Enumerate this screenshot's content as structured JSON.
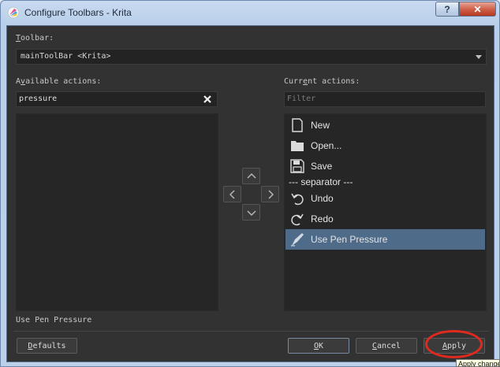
{
  "window": {
    "title": "Configure Toolbars - Krita",
    "help_glyph": "?",
    "close_glyph": "✕"
  },
  "toolbar": {
    "label_u": "T",
    "label_rest": "oolbar:",
    "selected": "mainToolBar <Krita>"
  },
  "available": {
    "label_pre": "A",
    "label_u": "v",
    "label_rest": "ailable actions:",
    "search_value": "pressure"
  },
  "current": {
    "label_pre": "Curr",
    "label_u": "e",
    "label_rest": "nt actions:",
    "filter_placeholder": "Filter",
    "items": [
      {
        "label": "New",
        "icon": "new-document-icon"
      },
      {
        "label": "Open...",
        "icon": "folder-icon"
      },
      {
        "label": "Save",
        "icon": "save-icon"
      },
      {
        "label": "--- separator ---",
        "icon": ""
      },
      {
        "label": "Undo",
        "icon": "undo-icon"
      },
      {
        "label": "Redo",
        "icon": "redo-icon"
      },
      {
        "label": "Use Pen Pressure",
        "icon": "pen-pressure-icon",
        "selected": true
      }
    ]
  },
  "status_text": "Use Pen Pressure",
  "buttons": {
    "defaults_u": "D",
    "defaults_rest": "efaults",
    "ok_u": "O",
    "ok_rest": "K",
    "cancel_u": "C",
    "cancel_rest": "ancel",
    "apply_u": "A",
    "apply_rest": "pply"
  },
  "tooltip": "Apply changes",
  "colors": {
    "accent_selection": "#4f6b8a",
    "annotation": "#e12a1e"
  }
}
